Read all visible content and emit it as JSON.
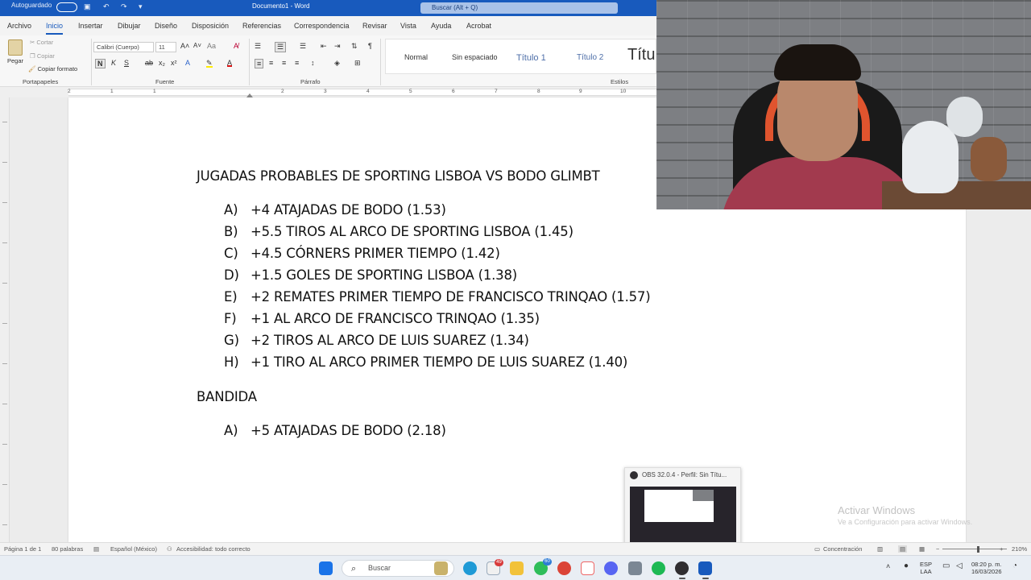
{
  "titlebar": {
    "autosave_label": "Autoguardado",
    "doc_title": "Documento1 - Word",
    "search_placeholder": "Buscar (Alt + Q)"
  },
  "ribbon": {
    "tabs": [
      "Archivo",
      "Inicio",
      "Insertar",
      "Dibujar",
      "Diseño",
      "Disposición",
      "Referencias",
      "Correspondencia",
      "Revisar",
      "Vista",
      "Ayuda",
      "Acrobat"
    ],
    "active_tab": "Inicio",
    "clipboard": {
      "paste": "Pegar",
      "cut": "Cortar",
      "copy": "Copiar",
      "format_painter": "Copiar formato",
      "group_label": "Portapapeles"
    },
    "font": {
      "font_name": "Calibri (Cuerpo)",
      "font_size": "11",
      "group_label": "Fuente"
    },
    "paragraph": {
      "group_label": "Párrafo"
    },
    "styles": {
      "items": [
        "Normal",
        "Sin espaciado",
        "Título 1",
        "Título 2",
        "Títu"
      ],
      "group_label": "Estilos"
    }
  },
  "ruler": {
    "numbers": [
      "2",
      "1",
      "1",
      "2",
      "3",
      "4",
      "5",
      "6",
      "7",
      "8",
      "9",
      "10"
    ]
  },
  "document": {
    "heading": "JUGADAS PROBABLES DE SPORTING LISBOA VS BODO GLIMBT",
    "items": [
      {
        "marker": "A)",
        "text": "+4 ATAJADAS DE BODO (1.53)"
      },
      {
        "marker": "B)",
        "text": "+5.5 TIROS AL ARCO DE SPORTING LISBOA (1.45)"
      },
      {
        "marker": "C)",
        "text": "+4.5 CÓRNERS PRIMER TIEMPO (1.42)"
      },
      {
        "marker": "D)",
        "text": "+1.5 GOLES DE SPORTING LISBOA (1.38)"
      },
      {
        "marker": "E)",
        "text": "+2 REMATES PRIMER TIEMPO DE FRANCISCO TRINQAO (1.57)"
      },
      {
        "marker": "F)",
        "text": "+1 AL ARCO DE FRANCISCO TRINQAO (1.35)"
      },
      {
        "marker": "G)",
        "text": "+2 TIROS AL ARCO DE LUIS SUAREZ (1.34)"
      },
      {
        "marker": "H)",
        "text": "+1 TIRO AL ARCO PRIMER TIEMPO DE LUIS SUAREZ (1.40)"
      }
    ],
    "section2_heading": "BANDIDA",
    "section2_items": [
      {
        "marker": "A)",
        "text": "+5 ATAJADAS DE BODO (2.18)"
      }
    ]
  },
  "watermark": {
    "title": "Activar Windows",
    "subtitle": "Ve a Configuración para activar Windows."
  },
  "obs_preview": {
    "title": "OBS 32.0.4 - Perfil: Sin Títu..."
  },
  "statusbar": {
    "page": "Página 1 de 1",
    "words": "80 palabras",
    "language": "Español (México)",
    "accessibility": "Accesibilidad: todo correcto",
    "focus": "Concentración",
    "zoom": "210%"
  },
  "taskbar": {
    "search_placeholder": "Buscar",
    "badges": {
      "telegram": "49",
      "whatsapp": "60"
    },
    "tray_lang_1": "ESP",
    "tray_lang_2": "LAA",
    "time": "08:20 p. m.",
    "date": "16/03/2026"
  },
  "colors": {
    "word_blue": "#185abd",
    "page_bg": "#ffffff",
    "app_bg": "#ececec"
  }
}
